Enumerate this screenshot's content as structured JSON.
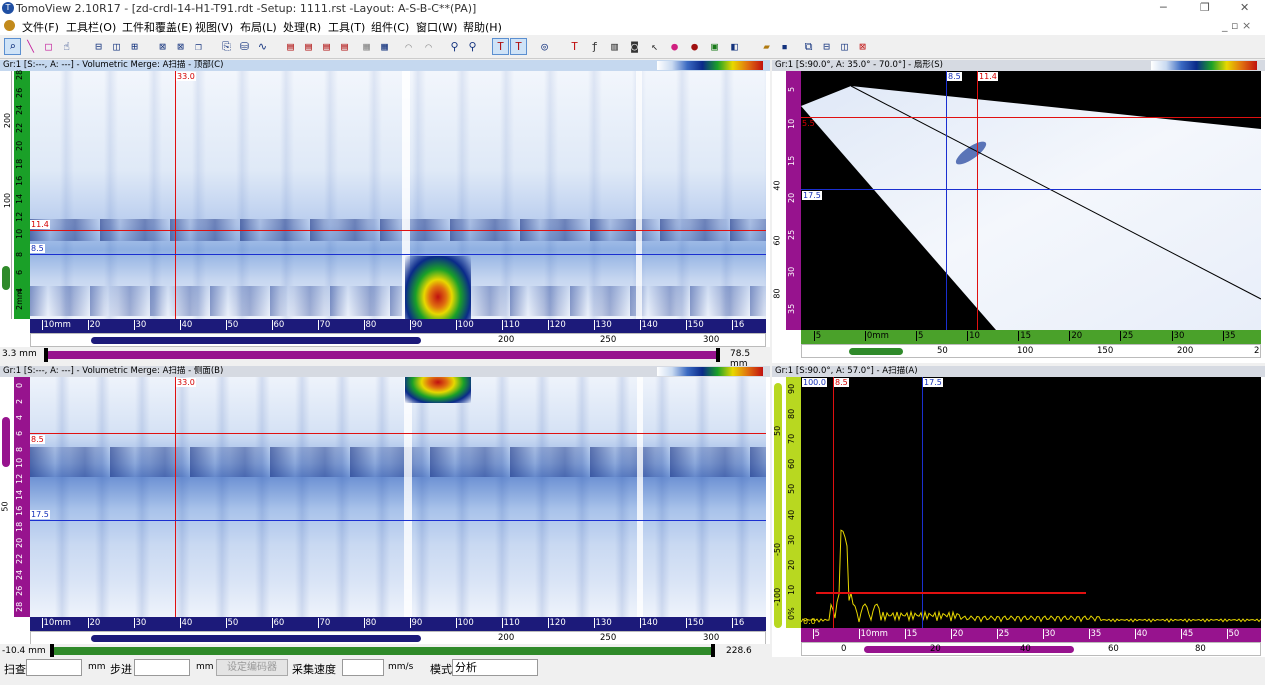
{
  "app": {
    "title": "TomoView 2.10R17 - [zd-crdl-14-H1-T91.rdt -Setup: 1111.rst -Layout: A-S-B-C**(PA)]"
  },
  "menu": [
    "文件(F)",
    "工具栏(O)",
    "工件和覆盖(E)",
    "视图(V)",
    "布局(L)",
    "处理(R)",
    "工具(T)",
    "组件(C)",
    "窗口(W)",
    "帮助(H)"
  ],
  "window_controls": {
    "minimize": "─",
    "restore": "❐",
    "close": "✕",
    "child": "_ ▫ ×"
  },
  "views": {
    "c_scan": {
      "title": "Gr:1 [S:---, A: ---] -  Volumetric Merge: A扫描 - 顶部(C)",
      "cursor_x": "33.0",
      "cursor_red": "11.4",
      "cursor_blue": "8.5",
      "range_min": "3.3 mm",
      "range_max": "78.5 mm",
      "x_ticks": [
        "10mm",
        "20",
        "30",
        "40",
        "50",
        "60",
        "70",
        "80",
        "90",
        "100",
        "110",
        "120",
        "130",
        "140",
        "150",
        "16"
      ],
      "y_ticks": [
        "28",
        "26",
        "24",
        "22",
        "20",
        "18",
        "16",
        "14",
        "12",
        "10",
        "8",
        "6",
        "4",
        "2mm"
      ],
      "y_ticks2": [
        "200",
        "100"
      ],
      "sub_ticks": [
        "200",
        "250",
        "300"
      ]
    },
    "s_scan": {
      "title": "Gr:1 [S:90.0°, A: 35.0° - 70.0°] - 扇形(S)",
      "cursor_blue": "8.5",
      "cursor_red": "11.4",
      "cursor_red_y": "5.5",
      "cursor_blue_y": "17.5",
      "x_ticks": [
        "5",
        "0mm",
        "5",
        "10",
        "15",
        "20",
        "25",
        "30",
        "35"
      ],
      "y_ticks": [
        "5",
        "10",
        "15",
        "20",
        "25",
        "30",
        "35"
      ],
      "y_ticks2": [
        "40",
        "60",
        "80"
      ],
      "sub_ticks": [
        "50",
        "100",
        "150",
        "200",
        "2"
      ]
    },
    "b_scan": {
      "title": "Gr:1 [S:---, A: ---] -  Volumetric Merge: A扫描 - 侧面(B)",
      "cursor_x": "33.0",
      "cursor_red": "8.5",
      "cursor_blue": "17.5",
      "range_min": "-10.4 mm",
      "range_max": "228.6 mm",
      "x_ticks": [
        "10mm",
        "20",
        "30",
        "40",
        "50",
        "60",
        "70",
        "80",
        "90",
        "100",
        "110",
        "120",
        "130",
        "140",
        "150",
        "16"
      ],
      "y_ticks": [
        "0",
        "2",
        "4",
        "6",
        "8",
        "10",
        "12",
        "14",
        "16",
        "18",
        "20",
        "22",
        "24",
        "26",
        "28"
      ],
      "y_ticks2": [
        "50"
      ],
      "sub_ticks": [
        "200",
        "250",
        "300"
      ]
    },
    "a_scan": {
      "title": "Gr:1 [S:90.0°, A: 57.0°] - A扫描(A)",
      "amp_max": "100.0",
      "amp_min": "0.0",
      "cursor_red": "8.5",
      "cursor_blue": "17.5",
      "y_ticks": [
        "90",
        "80",
        "70",
        "60",
        "50",
        "40",
        "30",
        "20",
        "10",
        "0%"
      ],
      "y_ticks2": [
        "50",
        "-50",
        "-100"
      ],
      "x_ticks": [
        "5",
        "10mm",
        "15",
        "20",
        "25",
        "30",
        "35",
        "40",
        "45",
        "50"
      ],
      "sub_ticks": [
        "0",
        "20",
        "40",
        "60",
        "80"
      ]
    }
  },
  "status": {
    "scan_label": "扫查",
    "scan_unit": "mm",
    "step_label": "步进",
    "step_unit": "mm",
    "encoder_button": "设定编码器",
    "speed_label": "采集速度",
    "speed_unit": "mm/s",
    "mode_label": "模式",
    "mode_value": "分析"
  },
  "colors": {
    "cursor_red": "#e01010",
    "cursor_blue": "#1a2fd0",
    "scale_purple": "#97138e",
    "scale_navy": "#1c1a7a",
    "scale_green": "#4aa12a",
    "ascan_trace": "#e8d800"
  }
}
